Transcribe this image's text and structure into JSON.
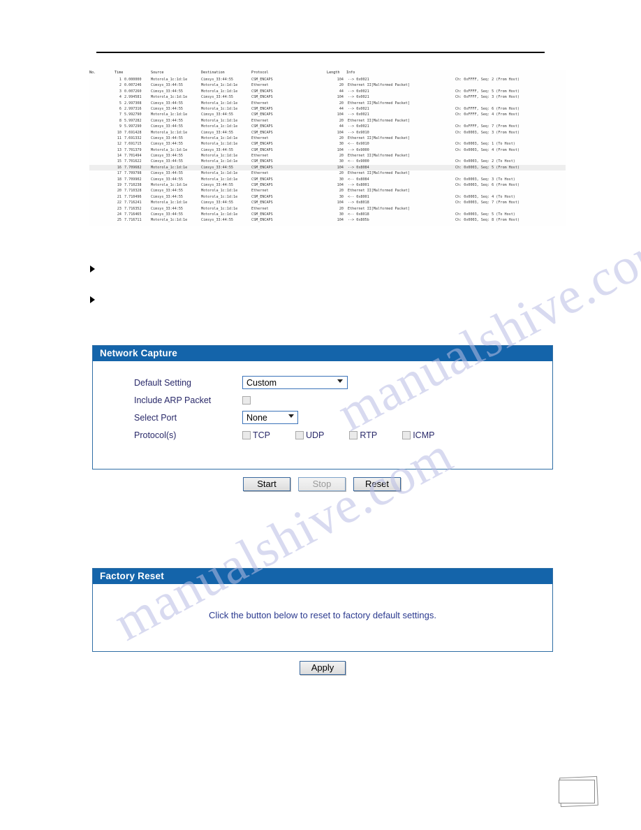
{
  "document": {
    "watermark_text": "manualshive.com"
  },
  "packet_capture": {
    "columns": [
      "No.",
      "Time",
      "Source",
      "Destination",
      "Protocol",
      "Length",
      "Info"
    ],
    "rows": [
      {
        "no": "1",
        "time": "0.000000",
        "source": "Motorola_1c:1d:1e",
        "destination": "Cimsys_33:44:55",
        "protocol": "CSM_ENCAPS",
        "length": "104",
        "info": "--> 0x0021",
        "extra": "Ch: 0xFFFF, Seq:  2 (From Host)",
        "highlight": false
      },
      {
        "no": "2",
        "time": "0.007246",
        "source": "Cimsys_33:44:55",
        "destination": "Motorola_1c:1d:1e",
        "protocol": "Ethernet",
        "length": "20",
        "info": "Ethernet II[Malformed Packet]",
        "extra": "",
        "highlight": false
      },
      {
        "no": "3",
        "time": "0.007260",
        "source": "Cimsys_33:44:55",
        "destination": "Motorola_1c:1d:1e",
        "protocol": "CSM_ENCAPS",
        "length": "44",
        "info": "--> 0x0021",
        "extra": "Ch: 0xFFFF, Seq:  5 (From Host)",
        "highlight": false
      },
      {
        "no": "4",
        "time": "2.994581",
        "source": "Motorola_1c:1d:1e",
        "destination": "Cimsys_33:44:55",
        "protocol": "CSM_ENCAPS",
        "length": "104",
        "info": "--> 0x0021",
        "extra": "Ch: 0xFFFF, Seq:  3 (From Host)",
        "highlight": false
      },
      {
        "no": "5",
        "time": "2.997308",
        "source": "Cimsys_33:44:55",
        "destination": "Motorola_1c:1d:1e",
        "protocol": "Ethernet",
        "length": "20",
        "info": "Ethernet II[Malformed Packet]",
        "extra": "",
        "highlight": false
      },
      {
        "no": "6",
        "time": "2.997316",
        "source": "Cimsys_33:44:55",
        "destination": "Motorola_1c:1d:1e",
        "protocol": "CSM_ENCAPS",
        "length": "44",
        "info": "--> 0x0021",
        "extra": "Ch: 0xFFFF, Seq:  6 (From Host)",
        "highlight": false
      },
      {
        "no": "7",
        "time": "5.992790",
        "source": "Motorola_1c:1d:1e",
        "destination": "Cimsys_33:44:55",
        "protocol": "CSM_ENCAPS",
        "length": "104",
        "info": "--> 0x0021",
        "extra": "Ch: 0xFFFF, Seq:  4 (From Host)",
        "highlight": false
      },
      {
        "no": "8",
        "time": "5.997282",
        "source": "Cimsys_33:44:55",
        "destination": "Motorola_1c:1d:1e",
        "protocol": "Ethernet",
        "length": "20",
        "info": "Ethernet II[Malformed Packet]",
        "extra": "",
        "highlight": false
      },
      {
        "no": "9",
        "time": "5.997290",
        "source": "Cimsys_33:44:55",
        "destination": "Motorola_1c:1d:1e",
        "protocol": "CSM_ENCAPS",
        "length": "44",
        "info": "--> 0x0021",
        "extra": "Ch: 0xFFFF, Seq:  7 (From Host)",
        "highlight": false
      },
      {
        "no": "10",
        "time": "7.691428",
        "source": "Motorola_1c:1d:1e",
        "destination": "Cimsys_33:44:55",
        "protocol": "CSM_ENCAPS",
        "length": "104",
        "info": "--> 0x9010",
        "extra": "Ch: 0x0003, Seq:  3 (From Host)",
        "highlight": false
      },
      {
        "no": "11",
        "time": "7.691332",
        "source": "Cimsys_33:44:55",
        "destination": "Motorola_1c:1d:1e",
        "protocol": "Ethernet",
        "length": "20",
        "info": "Ethernet II[Malformed Packet]",
        "extra": "",
        "highlight": false
      },
      {
        "no": "12",
        "time": "7.691715",
        "source": "Cimsys_33:44:55",
        "destination": "Motorola_1c:1d:1e",
        "protocol": "CSM_ENCAPS",
        "length": "30",
        "info": "<-- 0x9010",
        "extra": "Ch: 0x0003, Seq:  1 (To Host)",
        "highlight": false
      },
      {
        "no": "13",
        "time": "7.701379",
        "source": "Motorola_1c:1d:1e",
        "destination": "Cimsys_33:44:55",
        "protocol": "CSM_ENCAPS",
        "length": "104",
        "info": "--> 0x9000",
        "extra": "Ch: 0x0003, Seq:  4 (From Host)",
        "highlight": false
      },
      {
        "no": "14",
        "time": "7.701494",
        "source": "Cimsys_33:44:55",
        "destination": "Motorola_1c:1d:1e",
        "protocol": "Ethernet",
        "length": "20",
        "info": "Ethernet II[Malformed Packet]",
        "extra": "",
        "highlight": false
      },
      {
        "no": "15",
        "time": "7.701622",
        "source": "Cimsys_33:44:55",
        "destination": "Motorola_1c:1d:1e",
        "protocol": "CSM_ENCAPS",
        "length": "30",
        "info": "<-- 0x9000",
        "extra": "Ch: 0x0003, Seq:  2 (To Host)",
        "highlight": false
      },
      {
        "no": "16",
        "time": "7.709682",
        "source": "Motorola_1c:1d:1e",
        "destination": "Cimsys_33:44:55",
        "protocol": "CSM_ENCAPS",
        "length": "104",
        "info": "--> 0x8084",
        "extra": "Ch: 0x0003, Seq:  5 (From Host)",
        "highlight": true
      },
      {
        "no": "17",
        "time": "7.709798",
        "source": "Cimsys_33:44:55",
        "destination": "Motorola_1c:1d:1e",
        "protocol": "Ethernet",
        "length": "20",
        "info": "Ethernet II[Malformed Packet]",
        "extra": "",
        "highlight": false
      },
      {
        "no": "18",
        "time": "7.709902",
        "source": "Cimsys_33:44:55",
        "destination": "Motorola_1c:1d:1e",
        "protocol": "CSM_ENCAPS",
        "length": "30",
        "info": "<-- 0x8084",
        "extra": "Ch: 0x0003, Seq:  3 (To Host)",
        "highlight": false
      },
      {
        "no": "19",
        "time": "7.710238",
        "source": "Motorola_1c:1d:1e",
        "destination": "Cimsys_33:44:55",
        "protocol": "CSM_ENCAPS",
        "length": "104",
        "info": "--> 0x8001",
        "extra": "Ch: 0x0003, Seq:  6 (From Host)",
        "highlight": false
      },
      {
        "no": "20",
        "time": "7.710328",
        "source": "Cimsys_33:44:55",
        "destination": "Motorola_1c:1d:1e",
        "protocol": "Ethernet",
        "length": "20",
        "info": "Ethernet II[Malformed Packet]",
        "extra": "",
        "highlight": false
      },
      {
        "no": "21",
        "time": "7.710496",
        "source": "Cimsys_33:44:55",
        "destination": "Motorola_1c:1d:1e",
        "protocol": "CSM_ENCAPS",
        "length": "30",
        "info": "<-- 0x8001",
        "extra": "Ch: 0x0003, Seq:  4 (To Host)",
        "highlight": false
      },
      {
        "no": "22",
        "time": "7.716241",
        "source": "Motorola_1c:1d:1e",
        "destination": "Cimsys_33:44:55",
        "protocol": "CSM_ENCAPS",
        "length": "104",
        "info": "--> 0x8018",
        "extra": "Ch: 0x0003, Seq:  7 (From Host)",
        "highlight": false
      },
      {
        "no": "23",
        "time": "7.716352",
        "source": "Cimsys_33:44:55",
        "destination": "Motorola_1c:1d:1e",
        "protocol": "Ethernet",
        "length": "20",
        "info": "Ethernet II[Malformed Packet]",
        "extra": "",
        "highlight": false
      },
      {
        "no": "24",
        "time": "7.716465",
        "source": "Cimsys_33:44:55",
        "destination": "Motorola_1c:1d:1e",
        "protocol": "CSM_ENCAPS",
        "length": "30",
        "info": "<-- 0x8018",
        "extra": "Ch: 0x0003, Seq:  5 (To Host)",
        "highlight": false
      },
      {
        "no": "25",
        "time": "7.716711",
        "source": "Motorola_1c:1d:1e",
        "destination": "Cimsys_33:44:55",
        "protocol": "CSM_ENCAPS",
        "length": "104",
        "info": "--> 0x805b",
        "extra": "Ch: 0x0003, Seq:  8 (From Host)",
        "highlight": false
      }
    ]
  },
  "network_capture": {
    "title": "Network Capture",
    "default_setting": {
      "label": "Default Setting",
      "value": "Custom",
      "options": [
        "Custom"
      ]
    },
    "include_arp": {
      "label": "Include ARP Packet",
      "checked": false
    },
    "select_port": {
      "label": "Select Port",
      "value": "None",
      "options": [
        "None"
      ]
    },
    "protocols": {
      "label": "Protocol(s)",
      "items": [
        {
          "label": "TCP",
          "checked": false
        },
        {
          "label": "UDP",
          "checked": false
        },
        {
          "label": "RTP",
          "checked": false
        },
        {
          "label": "ICMP",
          "checked": false
        }
      ]
    },
    "buttons": [
      {
        "label": "Start",
        "disabled": false
      },
      {
        "label": "Stop",
        "disabled": true
      },
      {
        "label": "Reset",
        "disabled": false
      }
    ]
  },
  "factory_reset": {
    "title": "Factory Reset",
    "message": "Click the button below to reset to factory default settings.",
    "apply_label": "Apply"
  },
  "colors": {
    "panel_header_blue": "#1464aa",
    "panel_border_blue": "#2f6ea5",
    "label_text": "#2a2a6a",
    "message_text": "#2b3a8f",
    "watermark": "#b9bde4"
  }
}
